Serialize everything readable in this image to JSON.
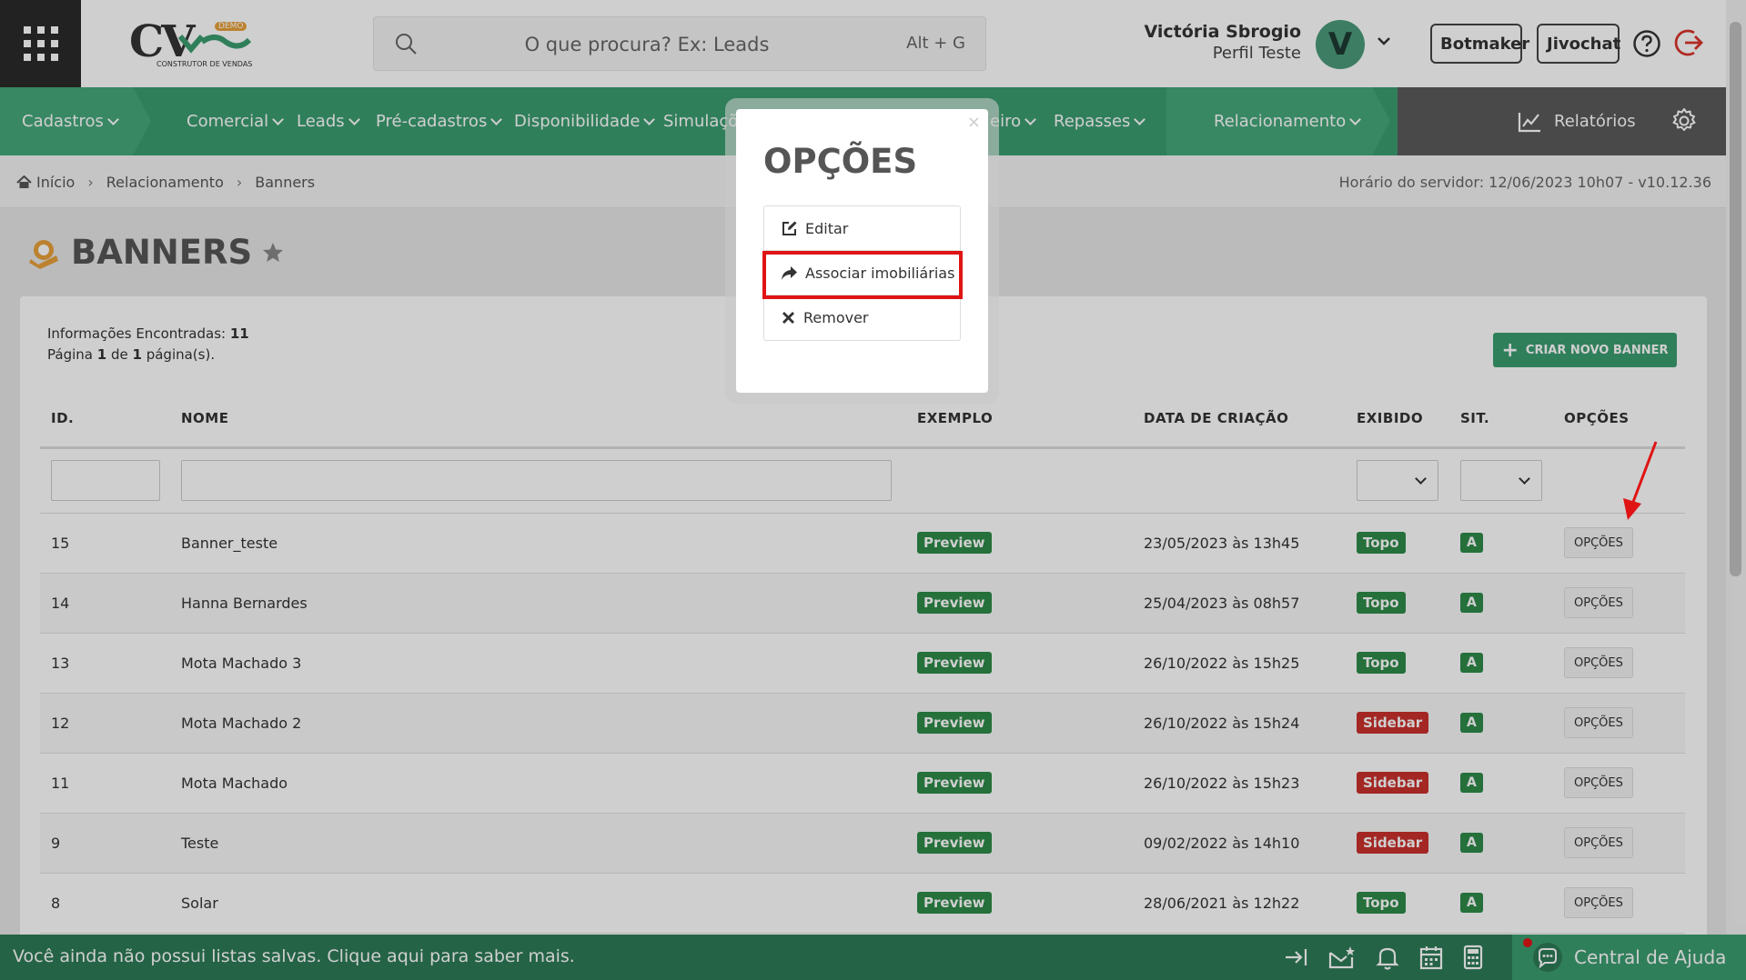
{
  "header": {
    "logo_main": "CV",
    "logo_badge": "DEMO",
    "logo_sub": "CONSTRUTOR DE VENDAS",
    "search_placeholder": "O que procura? Ex: Leads",
    "search_shortcut": "Alt + G",
    "user_name": "Victória Sbrogio",
    "user_role": "Perfil Teste",
    "avatar_letter": "V",
    "btn_botmaker": "Botmaker",
    "btn_jivochat": "Jivochat"
  },
  "nav": {
    "items": [
      {
        "label": "Cadastros"
      },
      {
        "label": "Comercial"
      },
      {
        "label": "Leads"
      },
      {
        "label": "Pré-cadastros"
      },
      {
        "label": "Disponibilidade"
      },
      {
        "label": "Simulaçõe"
      },
      {
        "label": "eiro"
      },
      {
        "label": "Repasses"
      },
      {
        "label": "Relacionamento"
      }
    ],
    "reports": "Relatórios"
  },
  "breadcrumb": {
    "home": "Início",
    "section": "Relacionamento",
    "current": "Banners",
    "server_time": "Horário do servidor: 12/06/2023 10h07 - v10.12.36"
  },
  "page": {
    "title": "BANNERS",
    "info_label": "Informações Encontradas:",
    "info_count": "11",
    "page_prefix": "Página",
    "page_num": "1",
    "page_of": "de",
    "page_total": "1",
    "page_suffix": "página(s).",
    "create_button": "CRIAR NOVO BANNER"
  },
  "table": {
    "headers": [
      "ID.",
      "NOME",
      "EXEMPLO",
      "DATA DE CRIAÇÃO",
      "EXIBIDO",
      "SIT.",
      "OPÇÕES"
    ],
    "rows": [
      {
        "id": "15",
        "name": "Banner_teste",
        "example": "Preview",
        "date": "23/05/2023 às 13h45",
        "shown": "Topo",
        "status": "A",
        "options": "OPÇÕES"
      },
      {
        "id": "14",
        "name": "Hanna Bernardes",
        "example": "Preview",
        "date": "25/04/2023 às 08h57",
        "shown": "Topo",
        "status": "A",
        "options": "OPÇÕES"
      },
      {
        "id": "13",
        "name": "Mota Machado 3",
        "example": "Preview",
        "date": "26/10/2022 às 15h25",
        "shown": "Topo",
        "status": "A",
        "options": "OPÇÕES"
      },
      {
        "id": "12",
        "name": "Mota Machado 2",
        "example": "Preview",
        "date": "26/10/2022 às 15h24",
        "shown": "Sidebar",
        "status": "A",
        "options": "OPÇÕES"
      },
      {
        "id": "11",
        "name": "Mota Machado",
        "example": "Preview",
        "date": "26/10/2022 às 15h23",
        "shown": "Sidebar",
        "status": "A",
        "options": "OPÇÕES"
      },
      {
        "id": "9",
        "name": "Teste",
        "example": "Preview",
        "date": "09/02/2022 às 14h10",
        "shown": "Sidebar",
        "status": "A",
        "options": "OPÇÕES"
      },
      {
        "id": "8",
        "name": "Solar",
        "example": "Preview",
        "date": "28/06/2021 às 12h22",
        "shown": "Topo",
        "status": "A",
        "options": "OPÇÕES"
      }
    ]
  },
  "modal": {
    "close": "×",
    "title": "OPÇÕES",
    "items": [
      {
        "label": "Editar"
      },
      {
        "label": "Associar imobiliárias"
      },
      {
        "label": "Remover"
      }
    ]
  },
  "bottom": {
    "message": "Você ainda não possui listas salvas. Clique aqui para saber mais.",
    "help_center": "Central de Ajuda"
  },
  "colors": {
    "brand_green": "#3c9d70",
    "dark_green": "#2d7a57",
    "badge_green": "#2e8a49",
    "badge_red": "#c9302c",
    "highlight_red": "#e01414"
  }
}
